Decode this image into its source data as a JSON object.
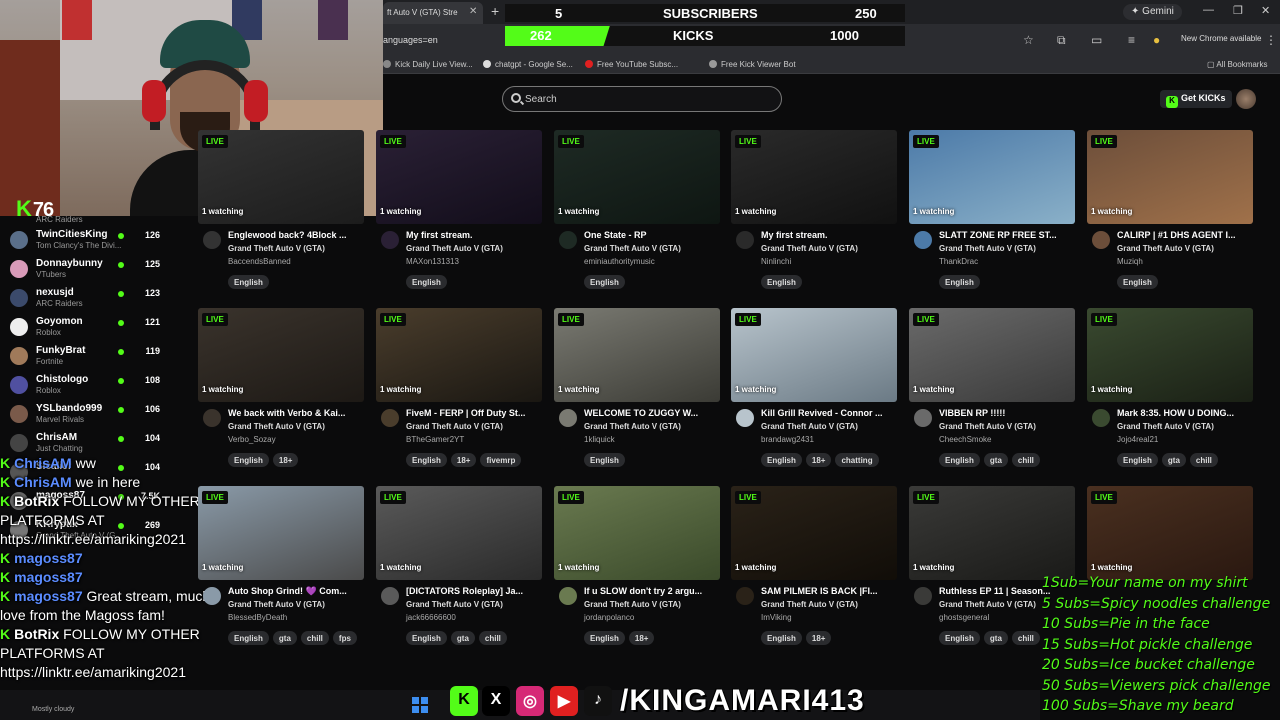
{
  "browser": {
    "tab_title": "ft Auto V (GTA) Stre",
    "url": "anguages=en",
    "gemini": "Gemini",
    "new_chrome": "New Chrome available",
    "bookmarks": [
      "Kick Daily Live View...",
      "chatgpt - Google Se...",
      "Free YouTube Subsc...",
      "Free Kick Viewer Bot"
    ],
    "all_bookmarks": "All Bookmarks"
  },
  "sub_counter": {
    "subs_current": "5",
    "subs_label": "SUBSCRIBERS",
    "subs_goal": "250",
    "kicks_current": "262",
    "kicks_label": "KICKS",
    "kicks_goal": "1000",
    "kicks_progress": 0.262
  },
  "header": {
    "search_placeholder": "Search",
    "get_kicks": "Get KICKs"
  },
  "webcam": {
    "viewer_count": "76"
  },
  "sidebar": {
    "top_category": "ARC Raiders",
    "items": [
      {
        "name": "TwinCitiesKing",
        "category": "Tom Clancy's The Divi...",
        "count": "126",
        "color": "#5a6f8a"
      },
      {
        "name": "Donnaybunny",
        "category": "VTubers",
        "count": "125",
        "color": "#d89ab8"
      },
      {
        "name": "nexusjd",
        "category": "ARC Raiders",
        "count": "123",
        "color": "#3b4a6b"
      },
      {
        "name": "Goyomon",
        "category": "Roblox",
        "count": "121",
        "color": "#eeeeee"
      },
      {
        "name": "FunkyBrat",
        "category": "Fortnite",
        "count": "119",
        "color": "#a07a5a"
      },
      {
        "name": "Chistologo",
        "category": "Roblox",
        "count": "108",
        "color": "#5050a0"
      },
      {
        "name": "YSLbando999",
        "category": "Marvel Rivals",
        "count": "106",
        "color": "#7a5a4a"
      },
      {
        "name": "ChrisAM",
        "category": "Just Chatting",
        "count": "104",
        "color": "#444"
      },
      {
        "name": "Sicalief",
        "category": "",
        "count": "104",
        "color": "#555"
      },
      {
        "name": "magoss87",
        "category": "",
        "count": "7.5K",
        "color": "#666"
      },
      {
        "name": "KKryptix",
        "category": "Grand Theft Auto V (G...",
        "count": "269",
        "color": "#777"
      }
    ]
  },
  "chat": [
    {
      "user": "ChrisAM",
      "msg": "ww",
      "color": "#5b8cff"
    },
    {
      "user": "ChrisAM",
      "msg": "we in here",
      "color": "#5b8cff"
    },
    {
      "user": "BotRix",
      "msg": "FOLLOW MY OTHER",
      "color": "#ffffff"
    },
    {
      "user": "",
      "msg": "PLATFORMS AT",
      "color": "#ffffff"
    },
    {
      "user": "",
      "msg": "https://linktr.ee/amariking2021",
      "color": "#ffffff"
    },
    {
      "user": "magoss87",
      "msg": "",
      "color": "#5b8cff"
    },
    {
      "user": "magoss87",
      "msg": "",
      "color": "#5b8cff"
    },
    {
      "user": "magoss87",
      "msg": "Great stream, much",
      "color": "#5b8cff"
    },
    {
      "user": "",
      "msg": "love from the Magoss fam!",
      "color": "#ffffff"
    },
    {
      "user": "BotRix",
      "msg": "FOLLOW MY OTHER",
      "color": "#ffffff"
    },
    {
      "user": "",
      "msg": "PLATFORMS AT",
      "color": "#ffffff"
    },
    {
      "user": "",
      "msg": "https://linktr.ee/amariking2021",
      "color": "#ffffff"
    }
  ],
  "streams": [
    {
      "title": "Englewood back? 4Block ...",
      "game": "Grand Theft Auto V (GTA)",
      "user": "BaccendsBanned",
      "tags": [
        "English"
      ],
      "watching": "1 watching",
      "colors": [
        "#333",
        "#1c1c1c"
      ]
    },
    {
      "title": "My first stream.",
      "game": "Grand Theft Auto V (GTA)",
      "user": "MAXon131313",
      "tags": [
        "English"
      ],
      "watching": "1 watching",
      "colors": [
        "#2a2035",
        "#120d1a"
      ]
    },
    {
      "title": "One State - RP",
      "game": "Grand Theft Auto V (GTA)",
      "user": "eminiauthoritymusic",
      "tags": [
        "English"
      ],
      "watching": "1 watching",
      "colors": [
        "#1e2a24",
        "#0e1612"
      ]
    },
    {
      "title": "My first stream.",
      "game": "Grand Theft Auto V (GTA)",
      "user": "Ninlinchi",
      "tags": [
        "English"
      ],
      "watching": "1 watching",
      "colors": [
        "#2a2a2a",
        "#111"
      ]
    },
    {
      "title": "SLATT ZONE RP FREE ST...",
      "game": "Grand Theft Auto V (GTA)",
      "user": "ThankDrac",
      "tags": [
        "English"
      ],
      "watching": "1 watching",
      "colors": [
        "#4c7aa8",
        "#8ab0c8"
      ]
    },
    {
      "title": "CALIRP | #1 DHS AGENT I...",
      "game": "Grand Theft Auto V (GTA)",
      "user": "Muziqh",
      "tags": [
        "English"
      ],
      "watching": "1 watching",
      "colors": [
        "#6c4e3a",
        "#a0714a"
      ]
    },
    {
      "title": "We back with Verbo & Kai...",
      "game": "Grand Theft Auto V (GTA)",
      "user": "Verbo_Sozay",
      "tags": [
        "English",
        "18+"
      ],
      "watching": "1 watching",
      "colors": [
        "#3a332c",
        "#1d1915"
      ]
    },
    {
      "title": "FiveM - FERP | Off Duty St...",
      "game": "Grand Theft Auto V (GTA)",
      "user": "BTheGamer2YT",
      "tags": [
        "English",
        "18+",
        "fivemrp"
      ],
      "watching": "1 watching",
      "colors": [
        "#4a3d2c",
        "#1a1712"
      ]
    },
    {
      "title": "WELCOME TO ZUGGY W...",
      "game": "Grand Theft Auto V (GTA)",
      "user": "1kliquick",
      "tags": [
        "English"
      ],
      "watching": "1 watching",
      "colors": [
        "#7a7a72",
        "#3b3b35"
      ]
    },
    {
      "title": "Kill Grill Revived - Connor ...",
      "game": "Grand Theft Auto V (GTA)",
      "user": "brandawg2431",
      "tags": [
        "English",
        "18+",
        "chatting"
      ],
      "watching": "1 watching",
      "colors": [
        "#b8c4cc",
        "#6b7a85"
      ]
    },
    {
      "title": "VIBBEN RP !!!!!",
      "game": "Grand Theft Auto V (GTA)",
      "user": "CheechSmoke",
      "tags": [
        "English",
        "gta",
        "chill"
      ],
      "watching": "1 watching",
      "colors": [
        "#6a6a6a",
        "#3a3a3a"
      ]
    },
    {
      "title": "Mark 8:35. HOW U DOING...",
      "game": "Grand Theft Auto V (GTA)",
      "user": "Jojo4real21",
      "tags": [
        "English",
        "gta",
        "chill"
      ],
      "watching": "1 watching",
      "colors": [
        "#3a4a30",
        "#1a2015"
      ]
    },
    {
      "title": "Auto Shop Grind! 💜 Com...",
      "game": "Grand Theft Auto V (GTA)",
      "user": "BlessedByDeath",
      "tags": [
        "English",
        "gta",
        "chill",
        "fps"
      ],
      "watching": "1 watching",
      "colors": [
        "#8a9aa8",
        "#4a4a4a"
      ]
    },
    {
      "title": "[DICTATORS Roleplay] Ja...",
      "game": "Grand Theft Auto V (GTA)",
      "user": "jack66666600",
      "tags": [
        "English",
        "gta",
        "chill"
      ],
      "watching": "1 watching",
      "colors": [
        "#5a5a5a",
        "#2a2a2a"
      ]
    },
    {
      "title": "If u SLOW don't try 2 argu...",
      "game": "Grand Theft Auto V (GTA)",
      "user": "jordanpolanco",
      "tags": [
        "English",
        "18+"
      ],
      "watching": "1 watching",
      "colors": [
        "#6a7a50",
        "#3a4a2a"
      ]
    },
    {
      "title": "SAM PILMER IS BACK |FI...",
      "game": "Grand Theft Auto V (GTA)",
      "user": "ImViking",
      "tags": [
        "English",
        "18+"
      ],
      "watching": "1 watching",
      "colors": [
        "#2a2218",
        "#110d08"
      ]
    },
    {
      "title": "Ruthless EP 11 | Season...",
      "game": "Grand Theft Auto V (GTA)",
      "user": "ghostsgeneral",
      "tags": [
        "English",
        "gta",
        "chill"
      ],
      "watching": "1 watching",
      "colors": [
        "#3a3a38",
        "#1a1a18"
      ]
    },
    {
      "title": "",
      "game": "",
      "user": "",
      "tags": [],
      "watching": "1 watching",
      "colors": [
        "#4a3020",
        "#2a1810"
      ]
    }
  ],
  "goals": [
    "1Sub=Your name on my shirt",
    "5 Subs=Spicy noodles challenge",
    "10 Subs=Pie in the face",
    "15 Subs=Hot pickle challenge",
    "20 Subs=Ice bucket challenge",
    "50 Subs=Viewers pick challenge",
    "100 Subs=Shave my beard"
  ],
  "footer": {
    "handle": "/KINGAMARI413",
    "weather": "Mostly cloudy",
    "socials": [
      "kick-icon",
      "x-icon",
      "instagram-icon",
      "youtube-icon",
      "tiktok-icon"
    ]
  },
  "colors": {
    "kick_green": "#53fc18",
    "chat_blue": "#5b8cff"
  }
}
